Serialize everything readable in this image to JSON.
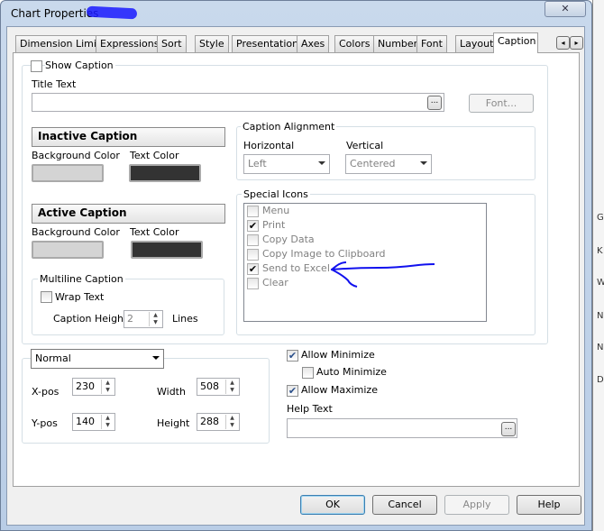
{
  "window": {
    "title": "Chart Properties",
    "close_glyph": "✕"
  },
  "tabs": [
    "Dimension Limits",
    "Expressions",
    "Sort",
    "Style",
    "Presentation",
    "Axes",
    "Colors",
    "Number",
    "Font",
    "Layout",
    "Caption"
  ],
  "active_tab": "Caption",
  "tab_scroll": {
    "left": "◂",
    "right": "▸"
  },
  "caption": {
    "show_caption": {
      "label": "Show Caption",
      "checked": false
    },
    "title_text": {
      "label": "Title Text",
      "value": "",
      "browse": "...",
      "font_button": "Font..."
    },
    "inactive": {
      "header": "Inactive Caption",
      "bg_label": "Background Color",
      "text_label": "Text Color",
      "bg_color": "#d4d4d4",
      "text_color": "#333333"
    },
    "active": {
      "header": "Active Caption",
      "bg_label": "Background Color",
      "text_label": "Text Color",
      "bg_color": "#d4d4d4",
      "text_color": "#333333"
    },
    "multiline": {
      "header": "Multiline Caption",
      "wrap_label": "Wrap Text",
      "wrap_checked": false,
      "height_label": "Caption Height",
      "height_value": "2",
      "lines_label": "Lines"
    },
    "alignment": {
      "header": "Caption Alignment",
      "horizontal_label": "Horizontal",
      "horizontal_value": "Left",
      "vertical_label": "Vertical",
      "vertical_value": "Centered"
    },
    "special_icons": {
      "header": "Special Icons",
      "items": [
        {
          "label": "Menu",
          "checked": false
        },
        {
          "label": "Print",
          "checked": true
        },
        {
          "label": "Copy Data",
          "checked": false
        },
        {
          "label": "Copy Image to Clipboard",
          "checked": false
        },
        {
          "label": "Send to Excel",
          "checked": true
        },
        {
          "label": "Clear",
          "checked": false
        }
      ]
    }
  },
  "position": {
    "mode": "Normal",
    "xpos_label": "X-pos",
    "xpos": "230",
    "ypos_label": "Y-pos",
    "ypos": "140",
    "width_label": "Width",
    "width": "508",
    "height_label": "Height",
    "height": "288"
  },
  "options": {
    "allow_minimize": "Allow Minimize",
    "auto_minimize": "Auto Minimize",
    "allow_maximize": "Allow Maximize",
    "help_text_label": "Help Text",
    "help_text": "",
    "browse": "..."
  },
  "buttons": {
    "ok": "OK",
    "cancel": "Cancel",
    "apply": "Apply",
    "help": "Help"
  },
  "background_letters": [
    "G",
    "K",
    "W",
    "N",
    "N",
    "D"
  ]
}
